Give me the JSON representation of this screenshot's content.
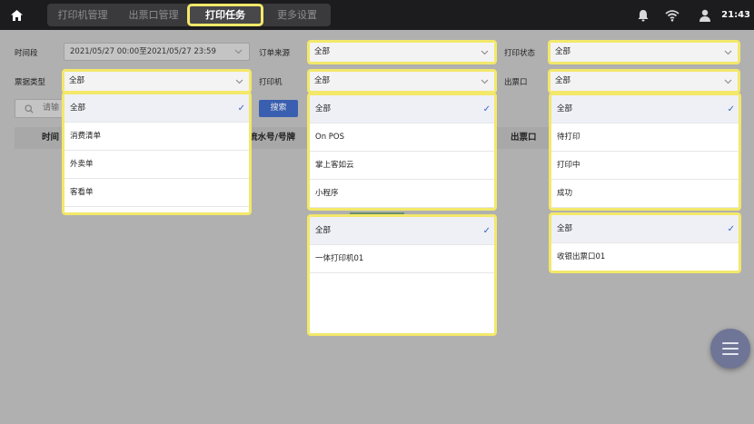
{
  "header": {
    "tabs": [
      {
        "label": "打印机管理"
      },
      {
        "label": "出票口管理"
      },
      {
        "label": "打印任务"
      },
      {
        "label": "更多设置"
      }
    ],
    "time": "21:43",
    "icons": [
      "home-icon",
      "bell-icon",
      "wifi-icon",
      "user-icon"
    ]
  },
  "filters": {
    "period_label": "时间段",
    "period_value": "2021/05/27 00:00至2021/05/27 23:59",
    "order_source_label": "订单来源",
    "order_source_value": "全部",
    "print_status_label": "打印状态",
    "print_status_value": "全部",
    "ticket_type_label": "票据类型",
    "ticket_type_value": "全部",
    "printer_label": "打印机",
    "printer_value": "全部",
    "outlet_label": "出票口",
    "outlet_value": "全部",
    "search_placeholder": "请输",
    "search_button": "搜索"
  },
  "table": {
    "headers": [
      "时间",
      "流水号/号牌",
      "出票口"
    ]
  },
  "dropdowns": {
    "ticket_type": {
      "options": [
        "全部",
        "消费清单",
        "外卖单",
        "客看单"
      ],
      "selected": 0
    },
    "order_source": {
      "options": [
        "全部",
        "On POS",
        "掌上客如云",
        "小程序"
      ],
      "selected": 0
    },
    "printer": {
      "options": [
        "全部",
        "一体打印机01"
      ],
      "selected": 0
    },
    "print_status": {
      "options": [
        "全部",
        "待打印",
        "打印中",
        "成功"
      ],
      "selected": 0
    },
    "outlet": {
      "options": [
        "全部",
        "收银出票口01"
      ],
      "selected": 0
    }
  },
  "colors": {
    "highlight": "#f3e86a",
    "accent": "#3b63c8",
    "search_button": "#3a5fb0"
  }
}
